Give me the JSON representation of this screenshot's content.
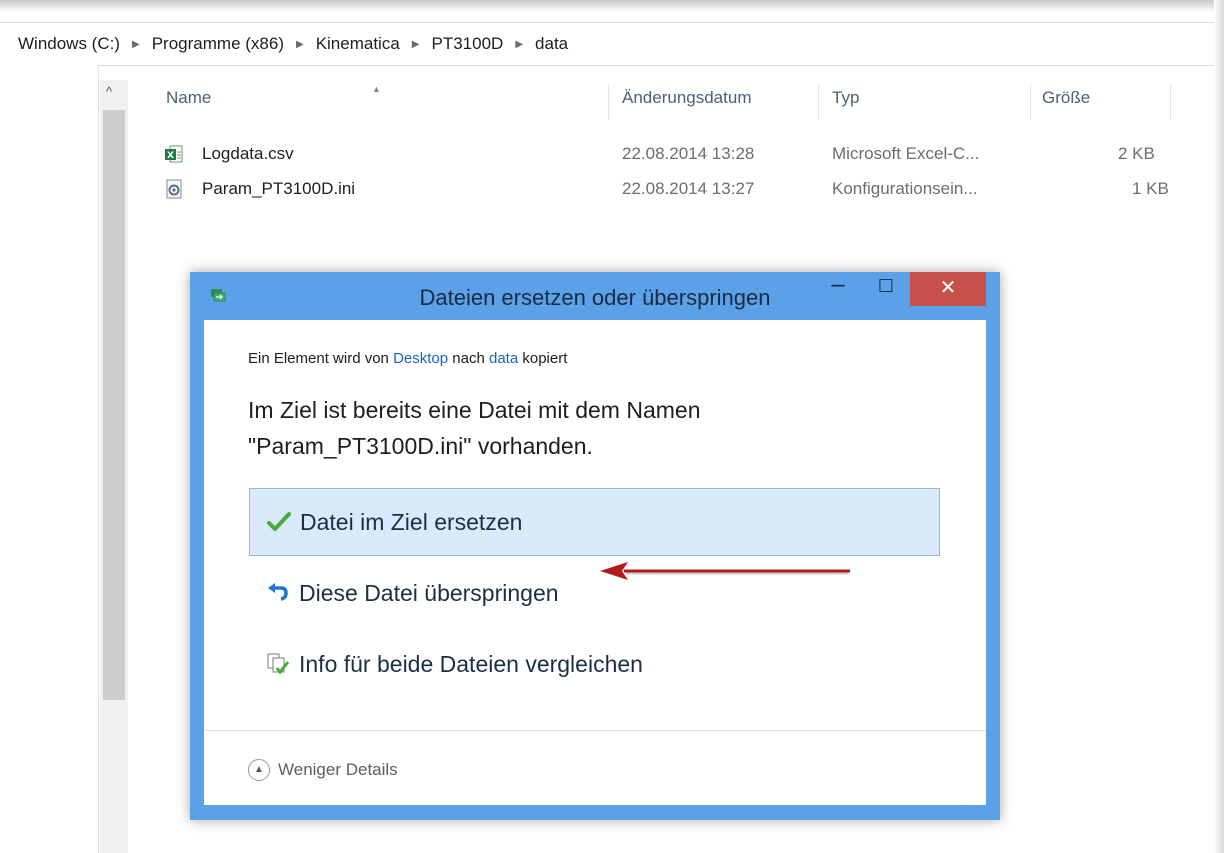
{
  "breadcrumb": [
    "Windows (C:)",
    "Programme (x86)",
    "Kinematica",
    "PT3100D",
    "data"
  ],
  "file_list": {
    "columns": {
      "name": "Name",
      "date": "Änderungsdatum",
      "type": "Typ",
      "size": "Größe"
    },
    "rows": [
      {
        "name": "Logdata.csv",
        "date": "22.08.2014 13:28",
        "type": "Microsoft Excel-C...",
        "size": "2 KB",
        "icon": "excel-csv-file-icon"
      },
      {
        "name": "Param_PT3100D.ini",
        "date": "22.08.2014 13:27",
        "type": "Konfigurationsein...",
        "size": "1 KB",
        "icon": "config-file-icon"
      }
    ]
  },
  "dialog": {
    "title": "Dateien ersetzen oder überspringen",
    "controls": {
      "minimize": "–",
      "maximize": "☐",
      "close": "✕"
    },
    "subtitle": {
      "prefix": "Ein Element wird von ",
      "source": "Desktop",
      "middle": " nach ",
      "target": "data",
      "suffix": " kopiert"
    },
    "message_line1": "Im Ziel ist bereits eine Datei mit dem Namen",
    "message_line2": "\"Param_PT3100D.ini\" vorhanden.",
    "options": [
      {
        "label": "Datei im Ziel ersetzen",
        "icon": "checkmark-icon",
        "selected": true
      },
      {
        "label": "Diese Datei überspringen",
        "icon": "skip-arrow-icon",
        "selected": false
      },
      {
        "label": "Info für beide Dateien vergleichen",
        "icon": "compare-files-icon",
        "selected": false
      }
    ],
    "footer": {
      "details_label": "Weniger Details"
    }
  },
  "colors": {
    "dialog_frame": "#5aa1e8",
    "close_button": "#c7504a",
    "selected_option_bg": "#dbeafb",
    "link": "#1a64c4",
    "annotation_arrow": "#b31b1b"
  }
}
